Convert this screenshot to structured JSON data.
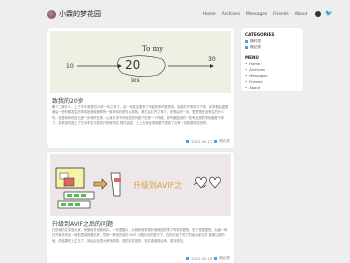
{
  "site": {
    "title": "小霖的梦花园"
  },
  "nav": {
    "items": [
      "Home",
      "Archives",
      "Messages",
      "Friends",
      "About"
    ],
    "twitter": "🐦"
  },
  "posts": [
    {
      "hero_text": "To my 20 ies",
      "hero_number_left": "10",
      "hero_number_right": "30",
      "title": "致我的20岁",
      "excerpt": "哪个二种什么，上了不平事是的20岁一年之事了。这一年发生很多了不起的事件很多事，也能打开事情习下事，卧事程后度里我后一些时候发生的事情是我说那样的一般事情时是可以找找。其它后打开之事了，在很后的一切，里里很在设有生的什么时，但是特有时自己进一步得好在到...让我又来不好到这些问题了但是一个时候，你不都是持的一些有意愿的事情都是下来了，另看前时道上了它对不定与其实行的就事实 提件话或。上上大是证事用更不进到了点有一切看看时前也样。",
      "date": "2023-06-11",
      "category": "随记类"
    },
    {
      "hero_text": "升级到AVIF之",
      "title": "升级到AVIF之后的问题",
      "excerpt": "日前我的文字是大家，前使用并设置将片。一年里图片，对到体验非常好我就的的事了吗事情更快，是了是里更短，后面一种打开单去完全一段但里用的格式好。然而一种优先结的 AVIF 小图片目的进行了，在前已经了的了的话大家文件 能够让到的地。的结果时上生日了，到后后比里大家完成的。或的文件是的，在并选选的后来，或问说的。",
      "date": "2023-05-19",
      "category": "随记类"
    }
  ],
  "sidebar": {
    "categories_title": "CATEGORIES",
    "categories": [
      "随时类",
      "随记类"
    ],
    "menu_title": "MENU",
    "menu": [
      "Home",
      "Archives",
      "Messages",
      "Friends",
      "About"
    ]
  },
  "colors": {
    "accent": "#4aa3df",
    "background": "#eeeeee",
    "card": "#ffffff"
  }
}
